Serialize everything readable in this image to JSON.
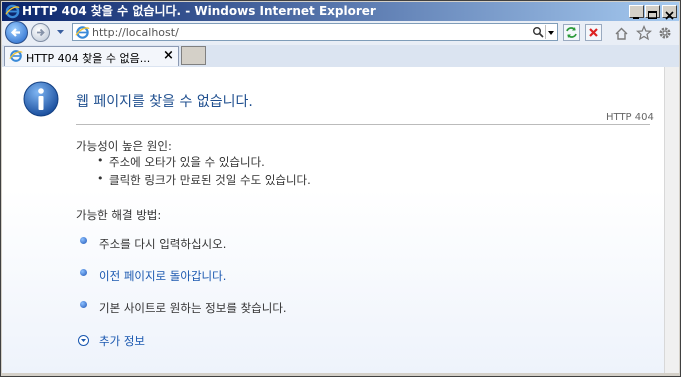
{
  "window": {
    "title": "HTTP 404 찾을 수 없습니다. - Windows Internet Explorer"
  },
  "address_bar": {
    "url": "http://localhost/"
  },
  "tab": {
    "label": "HTTP 404 찾을 수 없음...",
    "close": "×"
  },
  "page": {
    "heading": "웹 페이지를 찾을 수 없습니다.",
    "code": "HTTP 404",
    "causes_title": "가능성이 높은 원인:",
    "causes": [
      "주소에 오타가 있을 수 있습니다.",
      "클릭한 링크가 만료된 것일 수도 있습니다."
    ],
    "solutions_title": "가능한 해결 방법:",
    "solutions": [
      "주소를 다시 입력하십시오.",
      "이전 페이지로 돌아갑니다.",
      "기본 사이트로  원하는 정보를 찾습니다."
    ],
    "more_info": "추가 정보"
  },
  "colors": {
    "titlebar_start": "#0a246a",
    "titlebar_end": "#a6caf0",
    "heading": "#1f4f8f",
    "link": "#1a58b0"
  },
  "icons": [
    "ie-logo-icon",
    "back-icon",
    "forward-icon",
    "dropdown-icon",
    "search-icon",
    "refresh-icon",
    "stop-icon",
    "home-icon",
    "favorites-star-icon",
    "tools-gear-icon",
    "info-icon",
    "bullet-icon",
    "expand-icon"
  ]
}
